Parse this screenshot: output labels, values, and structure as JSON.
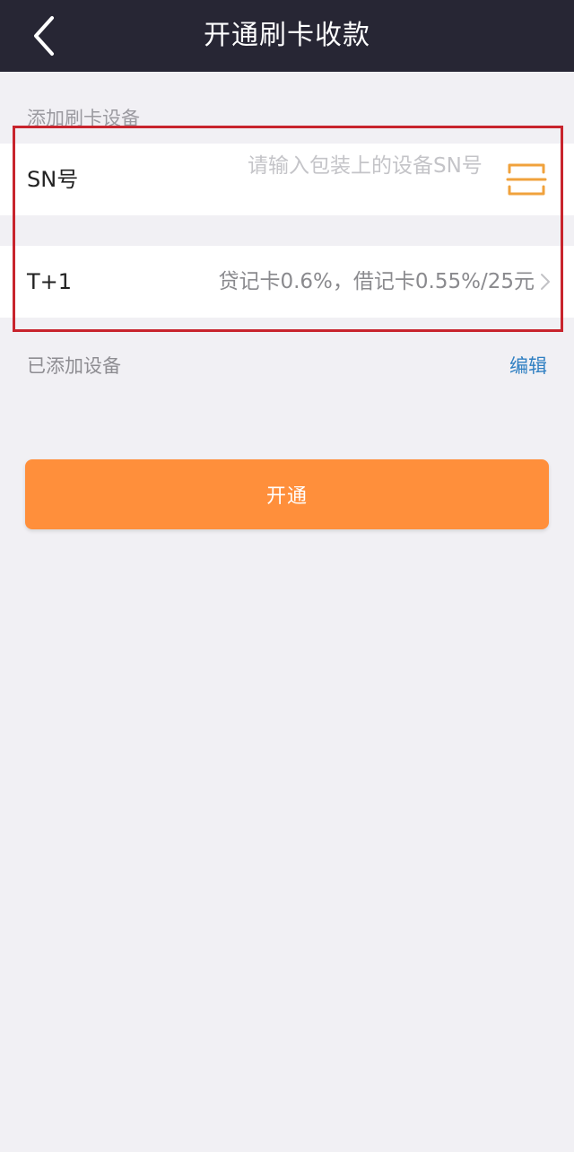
{
  "header": {
    "back_icon": "chevron-left-icon",
    "title": "开通刷卡收款"
  },
  "add_device_section": {
    "title": "添加刷卡设备",
    "sn_row": {
      "label": "SN号",
      "placeholder": "请输入包装上的设备SN号",
      "value": "",
      "scan_icon": "scan-icon",
      "icon_color": "#f0a23c"
    },
    "rate_row": {
      "label": "T+1",
      "value": "贷记卡0.6%，借记卡0.55%/25元",
      "icon": "chevron-right-icon"
    }
  },
  "added_devices": {
    "label": "已添加设备",
    "edit_label": "编辑"
  },
  "primary_button": {
    "label": "开通",
    "color": "#ff8f3b"
  },
  "colors": {
    "nav_background": "#272634",
    "highlight_border": "#c8242d",
    "link": "#2f7fc2"
  }
}
